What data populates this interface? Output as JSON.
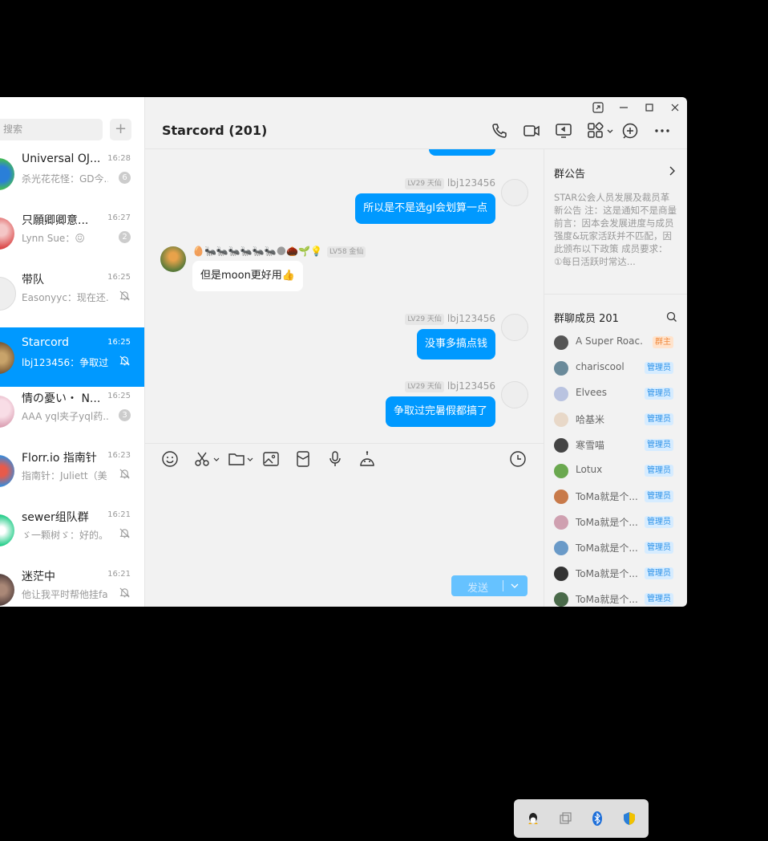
{
  "sidebar": {
    "search_placeholder": "搜索",
    "add": "+",
    "conversations": [
      {
        "name": "Universal OJ...",
        "time": "16:28",
        "preview": "杀光花花怪：GD今...",
        "badge": "6",
        "muted": false
      },
      {
        "name": "只願卿卿意...",
        "time": "16:27",
        "preview": "Lynn Sue：😖",
        "badge": "2",
        "muted": false
      },
      {
        "name": "带队",
        "time": "16:25",
        "preview": "Easonyyc：现在还...",
        "badge": "",
        "muted": true
      },
      {
        "name": "Starcord",
        "time": "16:25",
        "preview": "lbj123456：争取过...",
        "badge": "",
        "muted": true
      },
      {
        "name": "情の憂い・ N...",
        "time": "16:25",
        "preview": "AAA yql夹子yql药...",
        "badge": "3",
        "muted": false
      },
      {
        "name": "Florr.io 指南针",
        "time": "16:23",
        "preview": "指南针：Juliett（美...",
        "badge": "",
        "muted": true
      },
      {
        "name": "sewer组队群",
        "time": "16:21",
        "preview": "ゞ一颗树ゞ：好的。...",
        "badge": "",
        "muted": true
      },
      {
        "name": "迷茫中",
        "time": "16:21",
        "preview": "他让我平时帮他挂fah",
        "badge": "",
        "muted": true
      }
    ]
  },
  "chat": {
    "title": "Starcord (201)",
    "messages": [
      {
        "level": "LV29 天仙",
        "sender": "lbj123456",
        "text": "所以是不是选gl会划算一点"
      },
      {
        "level": "LV58 金仙",
        "sender": "🥚🐜🐜🐜🐜🐜🐜🌑🌰🌱💡",
        "text": "但是moon更好用👍"
      },
      {
        "level": "LV29 天仙",
        "sender": "lbj123456",
        "text": "没事多搞点钱"
      },
      {
        "level": "LV29 天仙",
        "sender": "lbj123456",
        "text": "争取过完暑假都搞了"
      }
    ],
    "send_label": "发送"
  },
  "panel": {
    "notice_title": "群公告",
    "notice_text": "STAR公会人员发展及裁员革新公告 注：这是通知不是商量 前言：因本会发展进度与成员强度&玩家活跃并不匹配，因此颁布以下政策 成员要求： ①每日活跃时常达...",
    "members_title": "群聊成员 201",
    "members": [
      {
        "name": "A Super Roac...",
        "role": "群主",
        "color": "#555"
      },
      {
        "name": "chariscool",
        "role": "管理员",
        "color": "#6a8a9a"
      },
      {
        "name": "Elvees",
        "role": "管理员",
        "color": "#b9c3e0"
      },
      {
        "name": "哈基米",
        "role": "管理员",
        "color": "#e8d8c8"
      },
      {
        "name": "寒雪喵",
        "role": "管理员",
        "color": "#444"
      },
      {
        "name": "Lotux",
        "role": "管理员",
        "color": "#6aa84f"
      },
      {
        "name": "ToMa就是个...",
        "role": "管理员",
        "color": "#c87a4a"
      },
      {
        "name": "ToMa就是个...",
        "role": "管理员",
        "color": "#cfa0b0"
      },
      {
        "name": "ToMa就是个...",
        "role": "管理员",
        "color": "#6a9ac8"
      },
      {
        "name": "ToMa就是个...",
        "role": "管理员",
        "color": "#333"
      },
      {
        "name": "ToMa就是个...",
        "role": "管理员",
        "color": "#4a6a4a"
      }
    ]
  },
  "colors": {
    "accent": "#0099ff"
  }
}
